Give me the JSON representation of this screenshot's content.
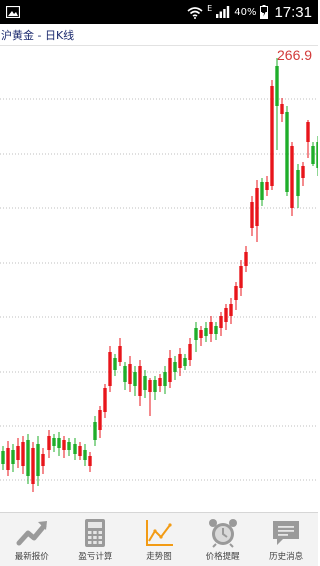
{
  "status_bar": {
    "network_type": "E",
    "battery": "40%",
    "time": "17:31"
  },
  "title": "沪黄金 - 日K线",
  "chart_data": {
    "type": "candlestick",
    "annotation": "266.9",
    "grid": true,
    "colors": {
      "up": "#e8151b",
      "down": "#1fae2a",
      "grid": "#bfbfbf",
      "label": "#d23a3a"
    }
  },
  "bottom_nav": {
    "items": [
      {
        "label": "最新报价",
        "icon": "trend-up-icon"
      },
      {
        "label": "盈亏计算",
        "icon": "calculator-icon"
      },
      {
        "label": "走势图",
        "icon": "line-chart-icon",
        "active": true
      },
      {
        "label": "价格提醒",
        "icon": "alarm-clock-icon"
      },
      {
        "label": "历史消息",
        "icon": "message-icon"
      }
    ]
  },
  "colors": {
    "accent": "#f29b14",
    "nav_icon": "#9a9a9a"
  }
}
